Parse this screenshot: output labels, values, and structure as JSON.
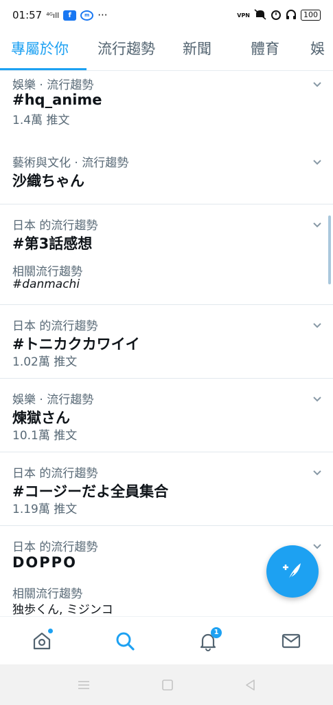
{
  "statusbar": {
    "time": "01:57",
    "signal_text": "⁴ᴳıll",
    "fb_label": "f",
    "messenger_label": "m",
    "more": "···",
    "vpn_label": "VPN",
    "battery": "100"
  },
  "tabs": [
    {
      "label": "專屬於你"
    },
    {
      "label": "流行趨勢"
    },
    {
      "label": "新聞"
    },
    {
      "label": "體育"
    },
    {
      "label": "娛"
    }
  ],
  "trends": [
    {
      "meta": "娛樂 · 流行趨勢",
      "title": "#hq_anime",
      "count": "1.4萬 推文"
    },
    {
      "meta": "藝術與文化 · 流行趨勢",
      "title": "沙織ちゃん"
    },
    {
      "meta": "日本 的流行趨勢",
      "title": "#第3話感想",
      "related_label": "相關流行趨勢",
      "related_value": "#danmachi"
    },
    {
      "meta": "日本 的流行趨勢",
      "title": "#トニカクカワイイ",
      "count": "1.02萬 推文"
    },
    {
      "meta": "娛樂 · 流行趨勢",
      "title": "煉獄さん",
      "count": "10.1萬 推文"
    },
    {
      "meta": "日本 的流行趨勢",
      "title": "#コージーだよ全員集合",
      "count": "1.19萬 推文"
    },
    {
      "meta": "日本 的流行趨勢",
      "title": "DOPPO",
      "related_label": "相關流行趨勢",
      "related_value": "独歩くん, ミジンコ"
    }
  ],
  "bottomnav": {
    "notifications_badge": "1"
  },
  "colors": {
    "accent": "#1da1f2",
    "secondary_text": "#586976"
  },
  "icons": [
    "home-icon",
    "search-icon",
    "bell-icon",
    "mail-icon",
    "compose-icon",
    "chevron-down-icon"
  ]
}
